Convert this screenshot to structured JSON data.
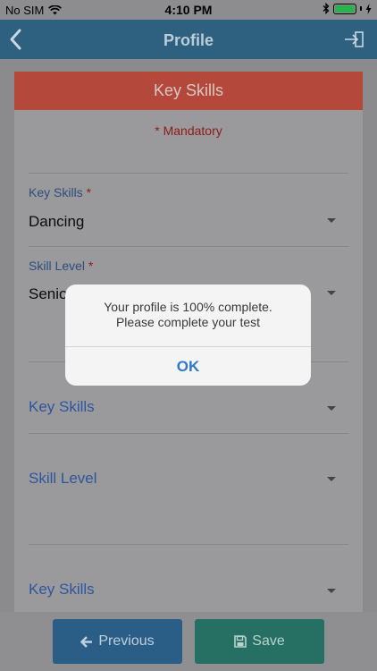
{
  "status_bar": {
    "carrier": "No SIM",
    "time": "4:10 PM"
  },
  "nav": {
    "title": "Profile"
  },
  "card": {
    "header": "Key Skills",
    "mandatory": "* Mandatory",
    "fields": [
      {
        "label": "Key Skills",
        "required": "*",
        "value": "Dancing"
      },
      {
        "label": "Skill Level",
        "required": "*",
        "value": "Senio"
      }
    ],
    "extra_fields": [
      {
        "placeholder": "Key Skills"
      },
      {
        "placeholder": "Skill Level"
      },
      {
        "placeholder": "Key Skills"
      }
    ]
  },
  "buttons": {
    "previous": "Previous",
    "save": "Save"
  },
  "alert": {
    "line1": "Your profile is 100% complete.",
    "line2": "Please complete your test",
    "ok": "OK"
  },
  "colors": {
    "nav_bg": "#2e607f",
    "header_bg": "#b4483a",
    "previous_bg": "#2a5e86",
    "save_bg": "#256f63",
    "alert_button": "#2f78c8"
  }
}
